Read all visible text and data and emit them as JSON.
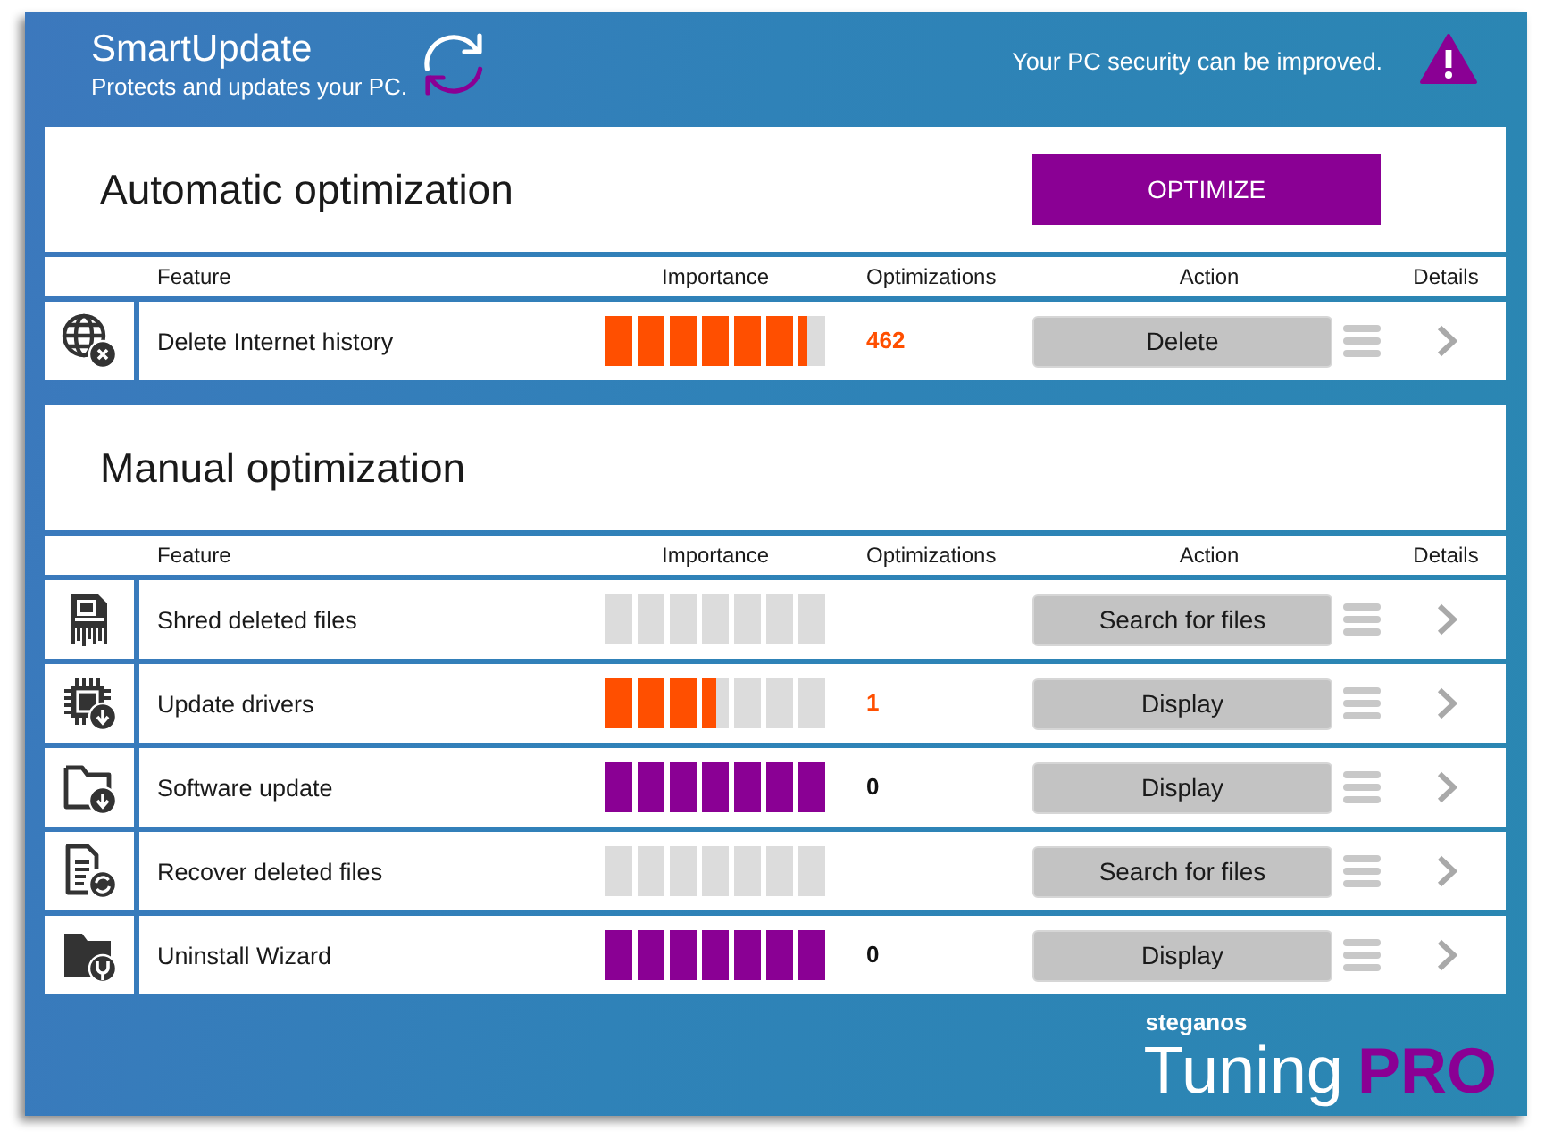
{
  "header": {
    "title": "SmartUpdate",
    "subtitle": "Protects and updates your PC.",
    "status": "Your PC security can be improved."
  },
  "sections": [
    {
      "title": "Automatic optimization",
      "button": "OPTIMIZE",
      "columns": {
        "feature": "Feature",
        "importance": "Importance",
        "optimizations": "Optimizations",
        "action": "Action",
        "details": "Details"
      },
      "rows": [
        {
          "kind": "internet",
          "feature": "Delete Internet history",
          "level": 0.92,
          "color": "#ff4f00",
          "count": {
            "text": "462",
            "color": "#ff4f00"
          },
          "action": "Delete"
        }
      ]
    },
    {
      "title": "Manual optimization",
      "columns": {
        "feature": "Feature",
        "importance": "Importance",
        "optimizations": "Optimizations",
        "action": "Action",
        "details": "Details"
      },
      "rows": [
        {
          "kind": "shred",
          "feature": "Shred deleted files",
          "level": 0,
          "action": "Search for files"
        },
        {
          "kind": "drivers",
          "feature": "Update drivers",
          "level": 0.5,
          "color": "#ff4f00",
          "count": {
            "text": "1",
            "color": "#ff4f00"
          },
          "action": "Display"
        },
        {
          "kind": "software",
          "feature": "Software update",
          "level": 1,
          "color": "#8a0094",
          "count": {
            "text": "0",
            "color": "#111111"
          },
          "action": "Display"
        },
        {
          "kind": "recover",
          "feature": "Recover deleted files",
          "level": 0,
          "action": "Search for files"
        },
        {
          "kind": "uninstall",
          "feature": "Uninstall Wizard",
          "level": 1,
          "color": "#8a0094",
          "count": {
            "text": "0",
            "color": "#111111"
          },
          "action": "Display"
        }
      ]
    }
  ],
  "brand": {
    "company": "steganos",
    "product": "Tuning",
    "edition": "PRO"
  }
}
